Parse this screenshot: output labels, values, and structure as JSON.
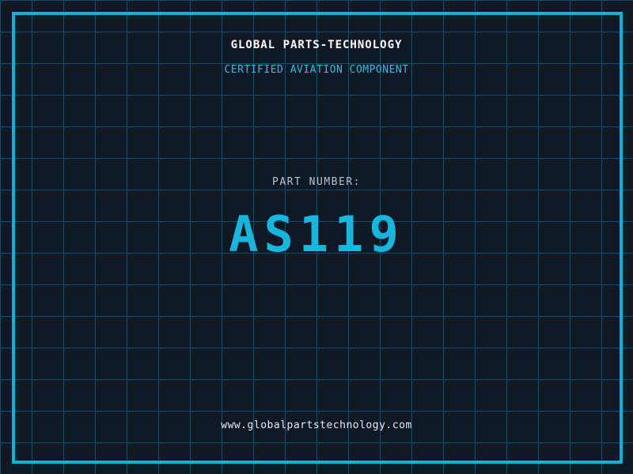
{
  "theme": {
    "background": "#101826",
    "grid_line": "#17506b",
    "frame_border": "#12b2d8",
    "title_color": "#ffffff",
    "subtitle_color": "#35bce4",
    "label_color": "#b9c3cb",
    "part_number_color": "#18b6dd",
    "url_color": "#e8eef2"
  },
  "header": {
    "title": "GLOBAL PARTS-TECHNOLOGY",
    "subtitle": "CERTIFIED AVIATION COMPONENT"
  },
  "part": {
    "label": "PART NUMBER:",
    "number": "AS119"
  },
  "footer": {
    "url": "www.globalpartstechnology.com"
  }
}
